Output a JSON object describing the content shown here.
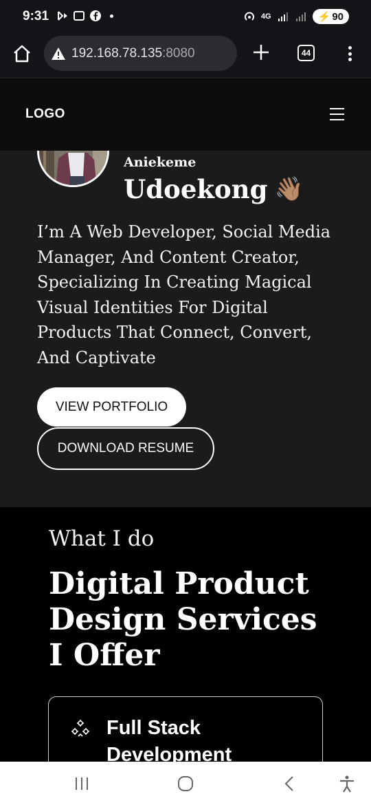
{
  "status_bar": {
    "time": "9:31",
    "network": "4G",
    "battery": "90"
  },
  "browser": {
    "url_host": "192.168.78.135",
    "url_port": ":8080",
    "tab_count": "44"
  },
  "header": {
    "logo": "LOGO"
  },
  "hero": {
    "first_name": "Aniekeme",
    "last_name": "Udoekong",
    "wave_emoji": "👋🏽",
    "bio": "I’m A Web Developer, Social Media Manager, And Content Creator, Specializing In Creating Magical Visual Identities For Digital Products That Connect, Convert, And Captivate",
    "primary_button": "VIEW PORTFOLIO",
    "secondary_button": "DOWNLOAD RESUME"
  },
  "services": {
    "eyebrow": "What I do",
    "heading": "Digital Product Design Services I Offer",
    "cards": [
      {
        "icon": "gear-cluster-icon",
        "title": "Full Stack Development"
      }
    ]
  },
  "colors": {
    "status_bg": "#131418",
    "header_bg": "#0c0c0c",
    "hero_bg": "#1b1b1b",
    "services_bg": "#000000"
  }
}
